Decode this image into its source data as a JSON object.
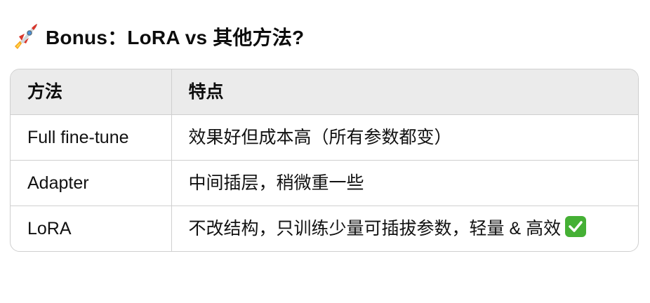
{
  "heading": {
    "icon": "rocket-icon",
    "text": "Bonus：LoRA vs 其他方法?"
  },
  "table": {
    "headers": [
      "方法",
      "特点"
    ],
    "rows": [
      {
        "method": "Full fine-tune",
        "feature": "效果好但成本高（所有参数都变）"
      },
      {
        "method": "Adapter",
        "feature": "中间插层，稍微重一些"
      },
      {
        "method": "LoRA",
        "feature": "不改结构，只训练少量可插拔参数，轻量 & 高效",
        "feature_icon": "check-mark-icon"
      }
    ]
  },
  "colors": {
    "header_bg": "#ebebeb",
    "border": "#cfcfcf",
    "check_bg": "#45b035"
  }
}
